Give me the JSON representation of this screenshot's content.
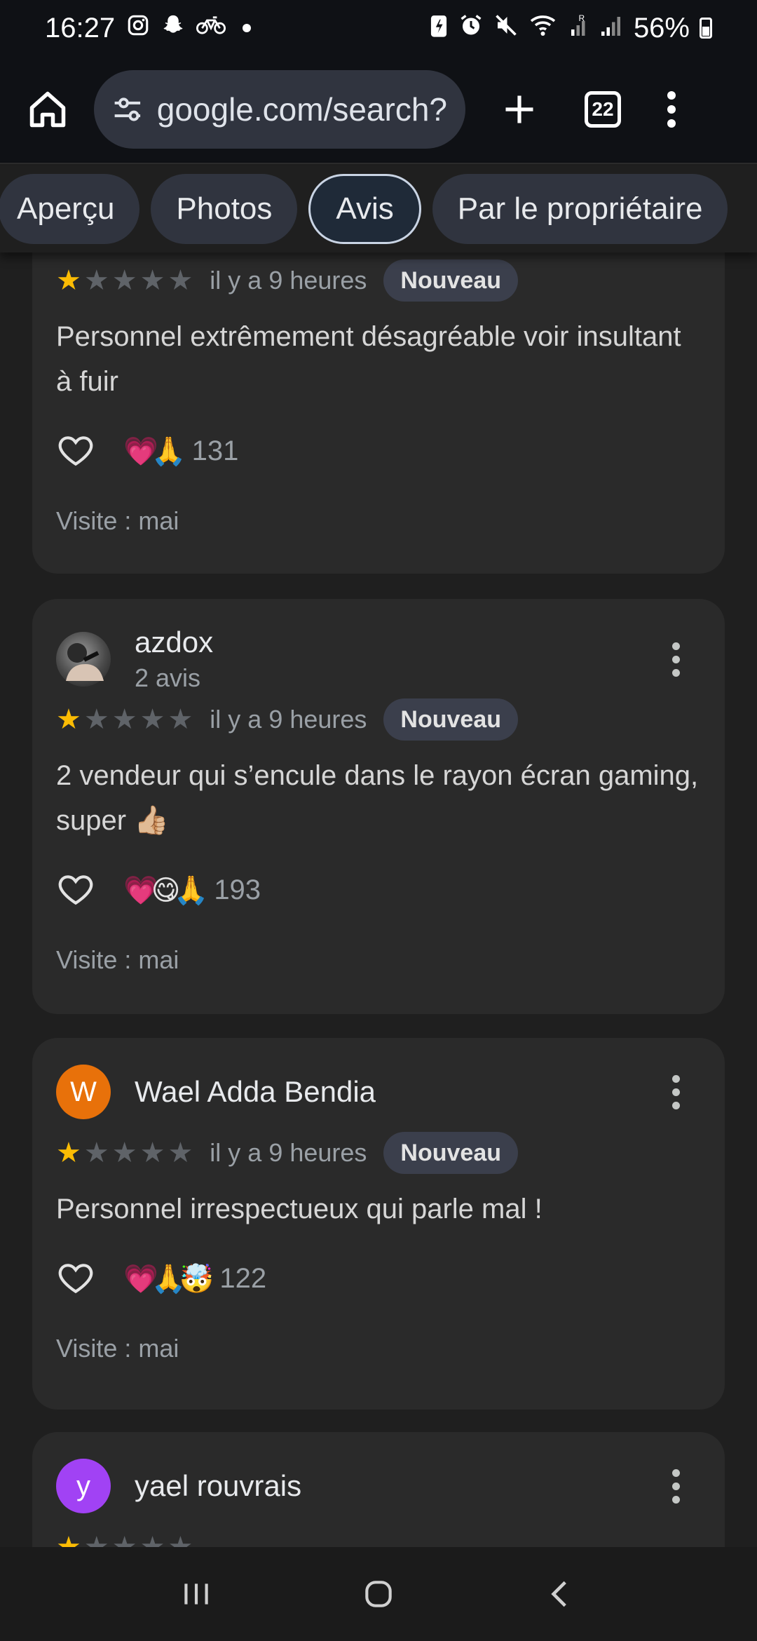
{
  "status_bar": {
    "time": "16:27",
    "battery": "56%"
  },
  "browser": {
    "url": "google.com/search?",
    "tab_count": "22"
  },
  "chips": [
    {
      "label": "Aperçu"
    },
    {
      "label": "Photos"
    },
    {
      "label": "Avis"
    },
    {
      "label": "Par le propriétaire"
    }
  ],
  "reviews": [
    {
      "time": "il y a 9 heures",
      "badge": "Nouveau",
      "text": "Personnel extrêmement désagréable voir insultant à fuir",
      "emojis": "💗🙏",
      "reaction_count": "131",
      "visit": "Visite : mai",
      "rating": 1
    },
    {
      "name": "azdox",
      "meta": "2 avis",
      "time": "il y a 9 heures",
      "badge": "Nouveau",
      "text": "2 vendeur qui s’encule dans le rayon écran gaming, super 👍🏼",
      "emojis": "💗😋🙏",
      "reaction_count": "193",
      "visit": "Visite : mai",
      "rating": 1
    },
    {
      "name": "Wael Adda Bendia",
      "avatar_letter": "W",
      "time": "il y a 9 heures",
      "badge": "Nouveau",
      "text": "Personnel irrespectueux qui parle mal !",
      "emojis": "💗🙏🤯",
      "reaction_count": "122",
      "visit": "Visite : mai",
      "rating": 1
    },
    {
      "name": "yael rouvrais",
      "avatar_letter": "y"
    }
  ],
  "colors": {
    "star_on": "#fbbc04",
    "avatar_w": "#e8710a",
    "avatar_y": "#a142f4"
  }
}
